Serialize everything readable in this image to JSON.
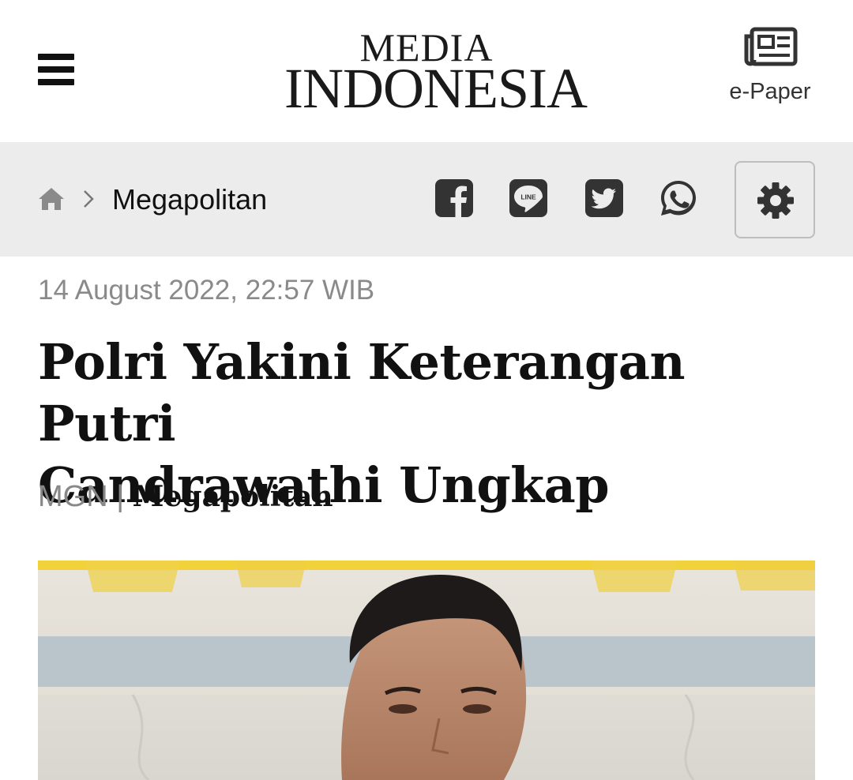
{
  "header": {
    "logo_top": "MEDIA",
    "logo_bottom": "INDONESIA",
    "epaper_label": "e-Paper"
  },
  "nav": {
    "breadcrumb_label": "Megapolitan",
    "share_icons": [
      "facebook-icon",
      "line-icon",
      "twitter-icon",
      "whatsapp-icon"
    ],
    "line_text": "LINE"
  },
  "article": {
    "date": "14 August 2022, 22:57 WIB",
    "title_line1": "Polri Yakini Keterangan Putri",
    "title_line2": "Candrawathi Ungkap",
    "source": "MGN",
    "separator": "|",
    "category": "Megapolitan"
  },
  "colors": {
    "header_bg": "#ffffff",
    "nav_bg": "#ececec",
    "icon_dark": "#333333",
    "muted_text": "#8a8a8a"
  }
}
